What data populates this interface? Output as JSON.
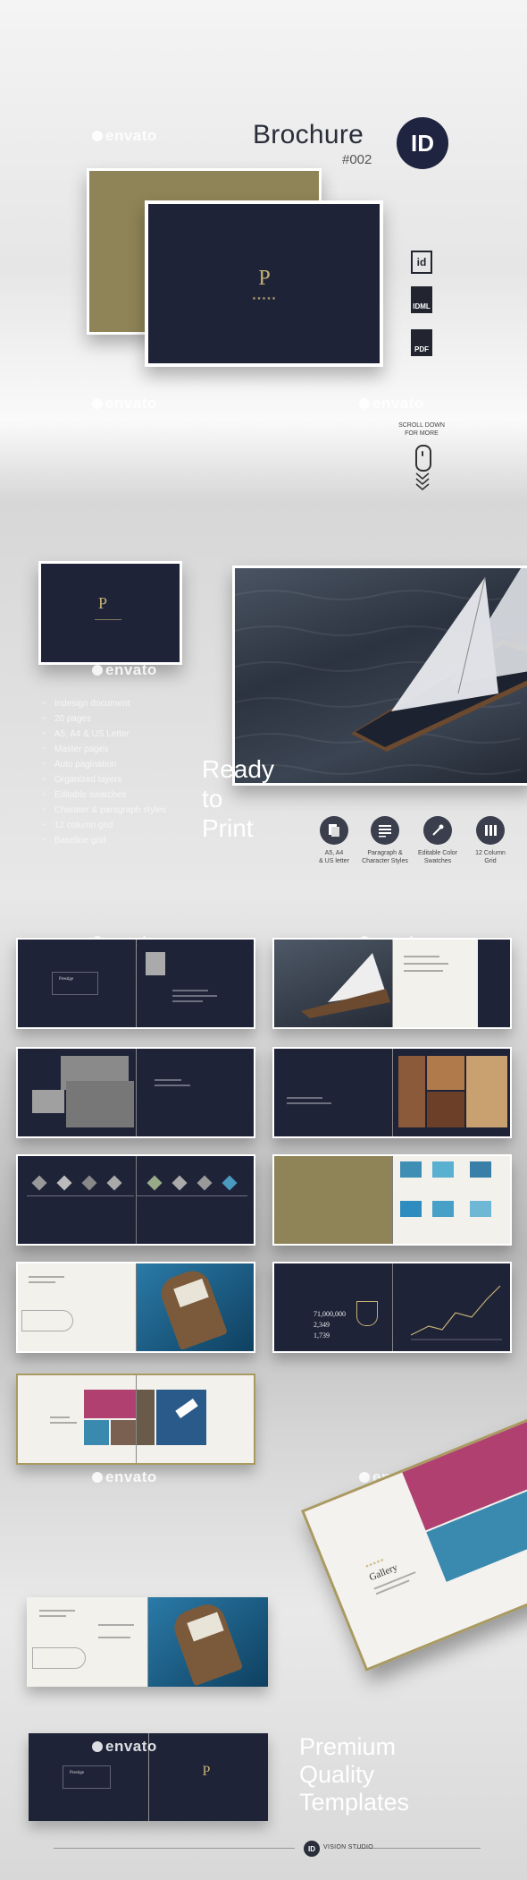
{
  "header": {
    "title": "Brochure",
    "subtitle": "#002",
    "logo_text": "ID"
  },
  "watermark": "envato",
  "file_formats": [
    "id",
    "IDML",
    "PDF"
  ],
  "scroll_hint": {
    "line1": "SCROLL DOWN",
    "line2": "FOR MORE"
  },
  "features": [
    "Indesign document",
    "20 pages",
    "A5, A4 & US Letter",
    "Master pages",
    "Auto pagination",
    "Organized layers",
    "Editable swatches",
    "Charater & paragraph styles",
    "12 column grid",
    "Baseline grid"
  ],
  "ready_text": [
    "Ready",
    "to",
    "Print"
  ],
  "spec_icons": [
    {
      "icon": "pages-icon",
      "label1": "A5, A4",
      "label2": "& US letter"
    },
    {
      "icon": "paragraph-icon",
      "label1": "Paragraph &",
      "label2": "Character Styles"
    },
    {
      "icon": "eyedropper-icon",
      "label1": "Editable Color",
      "label2": "Swatches"
    },
    {
      "icon": "grid-icon",
      "label1": "12 Column",
      "label2": "Grid"
    }
  ],
  "spread_text": {
    "prestige": "Prestige",
    "numbers": [
      "71,000,000",
      "2,349",
      "1,739"
    ],
    "gallery": "Gallery"
  },
  "footer": {
    "tagline": [
      "Premium",
      "Quality",
      "Templates"
    ],
    "brand": "VISION STUDIO",
    "brand_logo": "ID"
  },
  "colors": {
    "navy": "#1e2338",
    "gold": "#8e8457",
    "paper": "#f3f1ec"
  }
}
